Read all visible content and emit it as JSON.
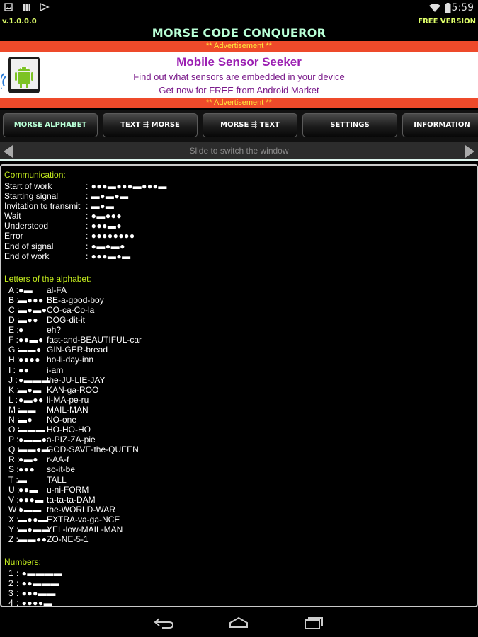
{
  "status": {
    "time": "5:59"
  },
  "header": {
    "version": "v.1.0.0.0",
    "free": "FREE VERSION",
    "title": "MORSE CODE CONQUEROR"
  },
  "ad": {
    "banner_top": "** Advertisement **",
    "banner_bottom": "** Advertisement **",
    "title": "Mobile Sensor Seeker",
    "line1": "Find out what sensors are embedded in your device",
    "line2": "Get now for FREE from Android Market"
  },
  "tabs": [
    {
      "label": "MORSE ALPHABET"
    },
    {
      "label": "TEXT ⇶ MORSE"
    },
    {
      "label": "MORSE ⇶ TEXT"
    },
    {
      "label": "SETTINGS"
    },
    {
      "label": "INFORMATION"
    }
  ],
  "slide_hint": "Slide to switch the window",
  "communication": {
    "title": "Communication:",
    "items": [
      {
        "label": "Start of work",
        "code": ": ●●●▬●●●▬●●●▬"
      },
      {
        "label": "Starting signal",
        "code": ": ▬●▬●▬"
      },
      {
        "label": "Invitation to transmit",
        "code": ": ▬●▬"
      },
      {
        "label": "Wait",
        "code": ": ●▬●●●"
      },
      {
        "label": "Understood",
        "code": ": ●●●▬●"
      },
      {
        "label": "Error",
        "code": ": ●●●●●●●●"
      },
      {
        "label": "End of signal",
        "code": ": ●▬●▬●"
      },
      {
        "label": "End of work",
        "code": ": ●●●▬●▬"
      }
    ]
  },
  "letters": {
    "title": "Letters of the alphabet:",
    "items": [
      {
        "letter": "A :",
        "code": "●▬",
        "mnemonic": "al-FA"
      },
      {
        "letter": "B :",
        "code": "▬●●●",
        "mnemonic": "BE-a-good-boy"
      },
      {
        "letter": "C :",
        "code": "▬●▬●",
        "mnemonic": "CO-ca-Co-la"
      },
      {
        "letter": "D :",
        "code": "▬●●",
        "mnemonic": "DOG-dit-it"
      },
      {
        "letter": "E :",
        "code": "●",
        "mnemonic": "eh?"
      },
      {
        "letter": "F :",
        "code": "●●▬●",
        "mnemonic": "fast-and-BEAUTIFUL-car"
      },
      {
        "letter": "G :",
        "code": "▬▬●",
        "mnemonic": "GIN-GER-bread"
      },
      {
        "letter": "H :",
        "code": "●●●●",
        "mnemonic": "ho-li-day-inn"
      },
      {
        "letter": "I :",
        "code": "●●",
        "mnemonic": "i-am"
      },
      {
        "letter": "J :",
        "code": "●▬▬▬",
        "mnemonic": "the-JU-LIE-JAY"
      },
      {
        "letter": "K :",
        "code": "▬●▬",
        "mnemonic": "KAN-ga-ROO"
      },
      {
        "letter": "L :",
        "code": "●▬●●",
        "mnemonic": "li-MA-pe-ru"
      },
      {
        "letter": "M :",
        "code": "▬▬",
        "mnemonic": "MAIL-MAN"
      },
      {
        "letter": "N :",
        "code": "▬●",
        "mnemonic": "NO-one"
      },
      {
        "letter": "O :",
        "code": "▬▬▬",
        "mnemonic": "HO-HO-HO"
      },
      {
        "letter": "P :",
        "code": "●▬▬●",
        "mnemonic": "a-PIZ-ZA-pie"
      },
      {
        "letter": "Q :",
        "code": "▬▬●▬",
        "mnemonic": "GOD-SAVE-the-QUEEN"
      },
      {
        "letter": "R :",
        "code": "●▬●",
        "mnemonic": "r-AA-f"
      },
      {
        "letter": "S :",
        "code": "●●●",
        "mnemonic": "so-it-be"
      },
      {
        "letter": "T :",
        "code": "▬",
        "mnemonic": "TALL"
      },
      {
        "letter": "U :",
        "code": "●●▬",
        "mnemonic": "u-ni-FORM"
      },
      {
        "letter": "V :",
        "code": "●●●▬",
        "mnemonic": "ta-ta-ta-DAM"
      },
      {
        "letter": "W :",
        "code": "●▬▬",
        "mnemonic": "the-WORLD-WAR"
      },
      {
        "letter": "X :",
        "code": "▬●●▬",
        "mnemonic": "EXTRA-va-ga-NCE"
      },
      {
        "letter": "Y :",
        "code": "▬●▬▬",
        "mnemonic": "YEL-low-MAIL-MAN"
      },
      {
        "letter": "Z :",
        "code": "▬▬●●",
        "mnemonic": "ZO-NE-5-1"
      }
    ]
  },
  "numbers": {
    "title": "Numbers:",
    "items": [
      {
        "code": "1 : ●▬▬▬▬"
      },
      {
        "code": "2 : ●●▬▬▬"
      },
      {
        "code": "3 : ●●●▬▬"
      },
      {
        "code": "4 : ●●●●▬"
      }
    ]
  }
}
